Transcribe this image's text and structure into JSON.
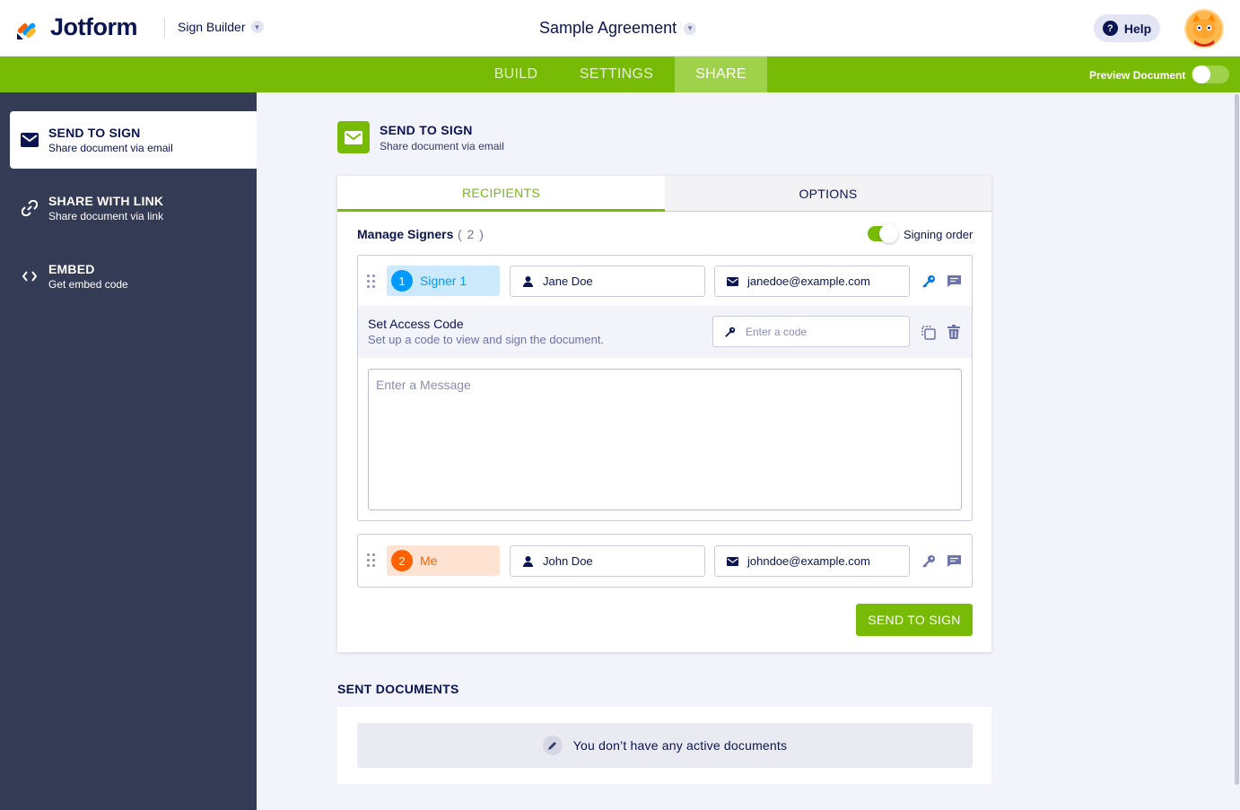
{
  "header": {
    "logo_text": "Jotform",
    "builder_label": "Sign Builder",
    "document_title": "Sample Agreement",
    "help_label": "Help"
  },
  "nav": {
    "tabs": [
      {
        "label": "BUILD"
      },
      {
        "label": "SETTINGS"
      },
      {
        "label": "SHARE"
      }
    ],
    "active_tab": "SHARE",
    "preview_label": "Preview Document",
    "preview_enabled": false
  },
  "sidebar": {
    "items": [
      {
        "title": "SEND TO SIGN",
        "subtitle": "Share document via email",
        "icon": "envelope-icon"
      },
      {
        "title": "SHARE WITH LINK",
        "subtitle": "Share document via link",
        "icon": "link-icon"
      },
      {
        "title": "EMBED",
        "subtitle": "Get embed code",
        "icon": "code-icon"
      }
    ],
    "active_index": 0
  },
  "main": {
    "section_title": "SEND TO SIGN",
    "section_subtitle": "Share document via email",
    "tabs": [
      {
        "label": "RECIPIENTS"
      },
      {
        "label": "OPTIONS"
      }
    ],
    "active_tab": "RECIPIENTS",
    "manage_label": "Manage Signers",
    "manage_count": "( 2 )",
    "signing_order_label": "Signing order",
    "signing_order_enabled": true,
    "signers": [
      {
        "number": "1",
        "role": "Signer 1",
        "name": "Jane Doe",
        "email": "janedoe@example.com",
        "color": "#0099ff",
        "bg": "#cdeafd"
      },
      {
        "number": "2",
        "role": "Me",
        "name": "John Doe",
        "email": "johndoe@example.com",
        "color": "#ff6100",
        "bg": "#ffe3d2"
      }
    ],
    "access_code": {
      "title": "Set Access Code",
      "subtitle": "Set up a code to view and sign the document.",
      "placeholder": "Enter a code"
    },
    "message_placeholder": "Enter a Message",
    "send_button": "SEND TO SIGN"
  },
  "sent": {
    "title": "SENT DOCUMENTS",
    "empty_text": "You don’t have any active documents"
  },
  "colors": {
    "brand_green": "#78bb07",
    "navy": "#0a1551",
    "sidebar": "#343c55"
  }
}
